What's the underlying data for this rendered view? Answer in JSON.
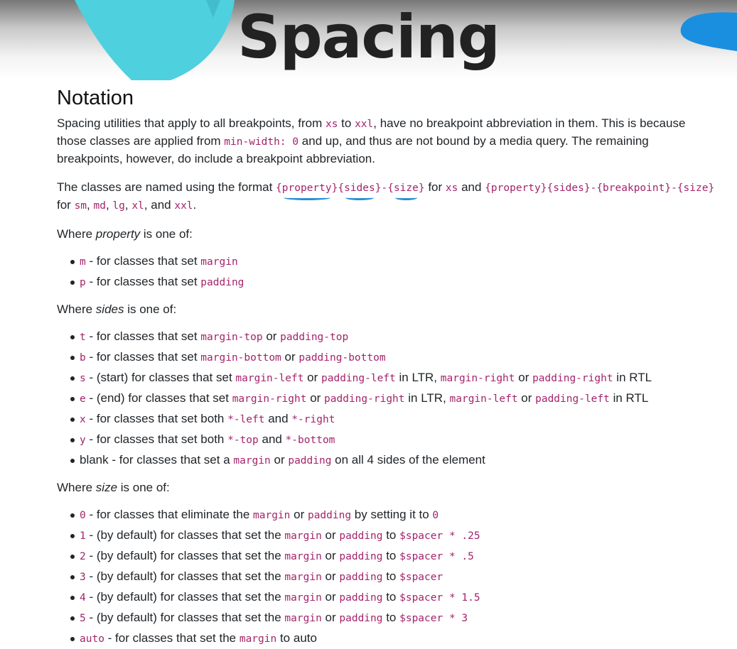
{
  "page_title": "Spacing",
  "heading": "Notation",
  "intro": {
    "t1": "Spacing utilities that apply to all breakpoints, from ",
    "c1": "xs",
    "t2": " to ",
    "c2": "xxl",
    "t3": ", have no breakpoint abbreviation in them. This is because those classes are applied from ",
    "c3": "min-width: 0",
    "t4": " and up, and thus are not bound by a media query. The remaining breakpoints, however, do include a breakpoint abbreviation."
  },
  "format": {
    "t1": "The classes are named using the format ",
    "f1": "{",
    "f2": "property",
    "f3": "}{",
    "f4": "sides",
    "f5": "}-{",
    "f6": "size",
    "f7": "}",
    "t2": " for ",
    "c1": "xs",
    "t3": " and ",
    "c2": "{property}{sides}-{breakpoint}-{size}",
    "t4": " for ",
    "c3": "sm",
    "t5": ", ",
    "c4": "md",
    "t6": ", ",
    "c5": "lg",
    "t7": ", ",
    "c6": "xl",
    "t8": ", and ",
    "c7": "xxl",
    "t9": "."
  },
  "property_heading": {
    "pre": "Where ",
    "em": "property",
    "post": " is one of:"
  },
  "property_items": [
    {
      "code": "m",
      "text": " - for classes that set ",
      "code2": "margin"
    },
    {
      "code": "p",
      "text": " - for classes that set ",
      "code2": "padding"
    }
  ],
  "sides_heading": {
    "pre": "Where ",
    "em": "sides",
    "post": " is one of:"
  },
  "sides_items": {
    "t": {
      "code": "t",
      "a": " - for classes that set ",
      "c1": "margin-top",
      "b": " or ",
      "c2": "padding-top"
    },
    "b": {
      "code": "b",
      "a": " - for classes that set ",
      "c1": "margin-bottom",
      "b": " or ",
      "c2": "padding-bottom"
    },
    "s": {
      "code": "s",
      "a": " - (start) for classes that set ",
      "c1": "margin-left",
      "b": " or ",
      "c2": "padding-left",
      "c": " in LTR, ",
      "c3": "margin-right",
      "d": " or ",
      "c4": "padding-right",
      "e": " in RTL"
    },
    "e": {
      "code": "e",
      "a": " - (end) for classes that set ",
      "c1": "margin-right",
      "b": " or ",
      "c2": "padding-right",
      "c": " in LTR, ",
      "c3": "margin-left",
      "d": " or ",
      "c4": "padding-left",
      "e": " in RTL"
    },
    "x": {
      "code": "x",
      "a": " - for classes that set both ",
      "c1": "*-left",
      "b": " and ",
      "c2": "*-right"
    },
    "y": {
      "code": "y",
      "a": " - for classes that set both ",
      "c1": "*-top",
      "b": " and ",
      "c2": "*-bottom"
    },
    "blank": {
      "a": "blank - for classes that set a ",
      "c1": "margin",
      "b": " or ",
      "c2": "padding",
      "c": " on all 4 sides of the element"
    }
  },
  "size_heading": {
    "pre": "Where ",
    "em": "size",
    "post": " is one of:"
  },
  "size_items": [
    {
      "code": "0",
      "a": " - for classes that eliminate the ",
      "c1": "margin",
      "b": " or ",
      "c2": "padding",
      "c": " by setting it to ",
      "c3": "0"
    },
    {
      "code": "1",
      "a": " - (by default) for classes that set the ",
      "c1": "margin",
      "b": " or ",
      "c2": "padding",
      "c": " to ",
      "c3": "$spacer * .25"
    },
    {
      "code": "2",
      "a": " - (by default) for classes that set the ",
      "c1": "margin",
      "b": " or ",
      "c2": "padding",
      "c": " to ",
      "c3": "$spacer * .5"
    },
    {
      "code": "3",
      "a": " - (by default) for classes that set the ",
      "c1": "margin",
      "b": " or ",
      "c2": "padding",
      "c": " to ",
      "c3": "$spacer"
    },
    {
      "code": "4",
      "a": " - (by default) for classes that set the ",
      "c1": "margin",
      "b": " or ",
      "c2": "padding",
      "c": " to ",
      "c3": "$spacer * 1.5"
    },
    {
      "code": "5",
      "a": " - (by default) for classes that set the ",
      "c1": "margin",
      "b": " or ",
      "c2": "padding",
      "c": " to ",
      "c3": "$spacer * 3"
    }
  ],
  "size_auto": {
    "code": "auto",
    "a": " - for classes that set the ",
    "c1": "margin",
    "b": " to auto"
  },
  "colors": {
    "code": "#a3246b",
    "annotation": "#2b8fd6",
    "banner_teal": "#4fd0de",
    "banner_blue": "#1a8fe0"
  }
}
